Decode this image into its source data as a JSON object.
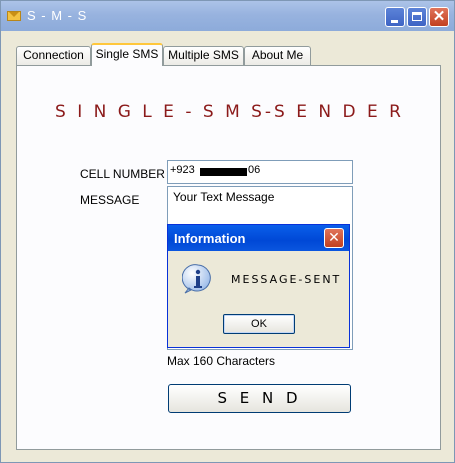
{
  "window": {
    "title": "S - M - S",
    "close_glyph": "✕",
    "icon": "envelope-icon"
  },
  "tabs": [
    {
      "label": "Connection",
      "active": false
    },
    {
      "label": "Single SMS",
      "active": true
    },
    {
      "label": "Multiple SMS",
      "active": false
    },
    {
      "label": "About Me",
      "active": false
    }
  ],
  "form": {
    "heading": "S I N G L E - S M S-S E N D E R",
    "cell_label": "CELL NUMBER",
    "cell_value_prefix": "+923",
    "cell_value_suffix": "06",
    "message_label": "MESSAGE",
    "message_value": "Your Text Message",
    "max_chars": "Max 160 Characters",
    "send_label": "S E N D"
  },
  "dialog": {
    "title": "Information",
    "close_glyph": "✕",
    "icon": "information-icon",
    "message": "MESSAGE-SENT",
    "ok_label": "OK"
  },
  "colors": {
    "heading": "#8B1A1A",
    "titlebar": "#98B3DF",
    "dialog_titlebar": "#0048D6"
  }
}
